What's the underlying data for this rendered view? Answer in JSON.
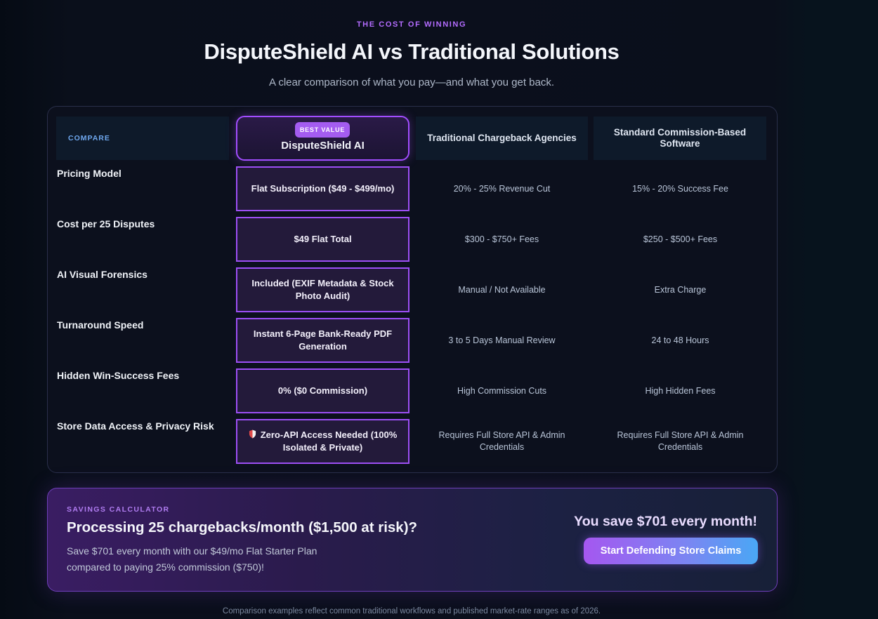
{
  "header": {
    "eyebrow": "THE COST OF WINNING",
    "title": "DisputeShield AI vs Traditional Solutions",
    "subtitle": "A clear comparison of what you pay—and what you get back."
  },
  "table": {
    "columns": {
      "compare": "COMPARE",
      "badge": "BEST VALUE",
      "dispute_shield": "DisputeShield AI",
      "traditional": "Traditional Chargeback Agencies",
      "standard": "Standard Commission-Based Software"
    },
    "rows": [
      {
        "label": "Pricing Model",
        "dispute_shield": "Flat Subscription ($49 - $499/mo)",
        "traditional": "20% - 25% Revenue Cut",
        "standard": "15% - 20% Success Fee"
      },
      {
        "label": "Cost per 25 Disputes",
        "dispute_shield": "$49 Flat Total",
        "traditional": "$300 - $750+ Fees",
        "standard": "$250 - $500+ Fees"
      },
      {
        "label": "AI Visual Forensics",
        "dispute_shield": "Included (EXIF Metadata & Stock Photo Audit)",
        "traditional": "Manual / Not Available",
        "standard": "Extra Charge"
      },
      {
        "label": "Turnaround Speed",
        "dispute_shield": "Instant 6-Page Bank-Ready PDF Generation",
        "traditional": "3 to 5 Days Manual Review",
        "standard": "24 to 48 Hours"
      },
      {
        "label": "Hidden Win-Success Fees",
        "dispute_shield": "0% ($0 Commission)",
        "traditional": "High Commission Cuts",
        "standard": "High Hidden Fees"
      },
      {
        "label": "Store Data Access & Privacy Risk",
        "dispute_shield": "Zero-API Access Needed (100% Isolated & Private)",
        "dispute_shield_icon": "shield-icon",
        "traditional": "Requires Full Store API & Admin Credentials",
        "standard": "Requires Full Store API & Admin Credentials"
      }
    ]
  },
  "savings": {
    "eyebrow": "SAVINGS CALCULATOR",
    "title": "Processing 25 chargebacks/month ($1,500 at risk)?",
    "description": "Save $701 every month with our $49/mo Flat Starter Plan compared to paying 25% commission ($750)!",
    "save_text": "You save $701 every month!",
    "button_label": "Start Defending Store Claims"
  },
  "footnote": "Comparison examples reflect common traditional workflows and published market-rate ranges as of 2026.",
  "colors": {
    "accent": "#a24dff",
    "compare_label": "#6fa8ef",
    "button_start": "#a557f0",
    "button_end": "#4aa7f5"
  }
}
